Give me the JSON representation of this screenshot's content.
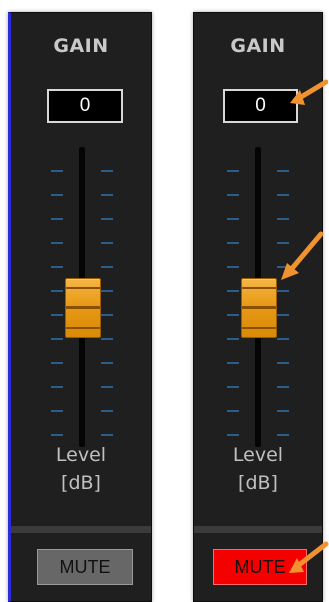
{
  "channels": [
    {
      "title": "GAIN",
      "gain_value": "0",
      "level_label": "Level",
      "unit_label": "[dB]",
      "mute_label": "MUTE",
      "mute_active": false,
      "fader_level": 0.5
    },
    {
      "title": "GAIN",
      "gain_value": "0",
      "level_label": "Level",
      "unit_label": "[dB]",
      "mute_label": "MUTE",
      "mute_active": true,
      "fader_level": 0.5
    }
  ],
  "colors": {
    "strip_bg": "#1f1f1f",
    "fader_thumb": "#e79a16",
    "tick_marks": "#2c5d8a",
    "mute_off": "#676767",
    "mute_on": "#f40000",
    "annotation_arrow": "#f0922f"
  },
  "annotations": [
    {
      "target": "gain-value-display",
      "icon": "arrow-icon"
    },
    {
      "target": "fader-thumb",
      "icon": "arrow-icon"
    },
    {
      "target": "mute-button",
      "icon": "arrow-icon"
    }
  ]
}
